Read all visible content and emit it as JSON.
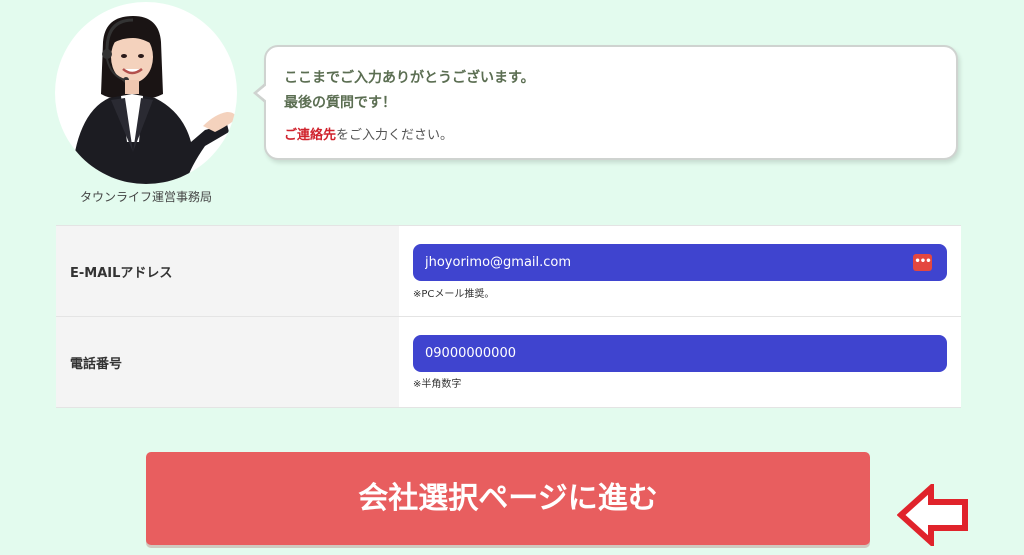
{
  "operator": {
    "caption": "タウンライフ運営事務局",
    "avatar_icon": "operator-woman-headset"
  },
  "bubble": {
    "line1": "ここまでご入力ありがとうございます。",
    "line2": "最後の質問です！",
    "line3_emphasis": "ご連絡先",
    "line3_rest": "をご入力ください。"
  },
  "form": {
    "email": {
      "label": "E-MAILアドレス",
      "value": "jhoyorimo@gmail.com",
      "hint": "※PCメール推奨。"
    },
    "phone": {
      "label": "電話番号",
      "value": "09000000000",
      "hint": "※半角数字"
    }
  },
  "submit": {
    "label": "会社選択ページに進む"
  },
  "colors": {
    "page_bg": "#e3fbee",
    "input_fill": "#3f44cf",
    "button": "#e85e5f",
    "emphasis_text": "#d0232d",
    "arrow": "#e0232b"
  }
}
